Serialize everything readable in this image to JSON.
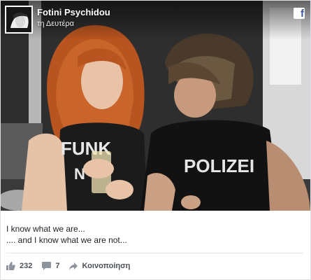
{
  "post": {
    "author": "Fotini Psychidou",
    "timestamp": "τη Δευτέρα",
    "photo": {
      "shirt_left_text": "FUNK",
      "shirt_left_text_2": "N",
      "shirt_right_text": "POLIZEI"
    },
    "caption_lines": [
      "I know what we are...",
      ".... and I know what we are not..."
    ]
  },
  "actions": {
    "likes": "232",
    "comments": "7",
    "share_label": "Κοινοποίηση"
  },
  "icons": {
    "brand": "facebook-icon",
    "like": "thumbs-up-icon",
    "comment": "comment-icon",
    "share": "share-arrow-icon"
  },
  "colors": {
    "facebook_blue": "#3b5998",
    "text": "#1d2129",
    "muted": "#4b4f56"
  }
}
